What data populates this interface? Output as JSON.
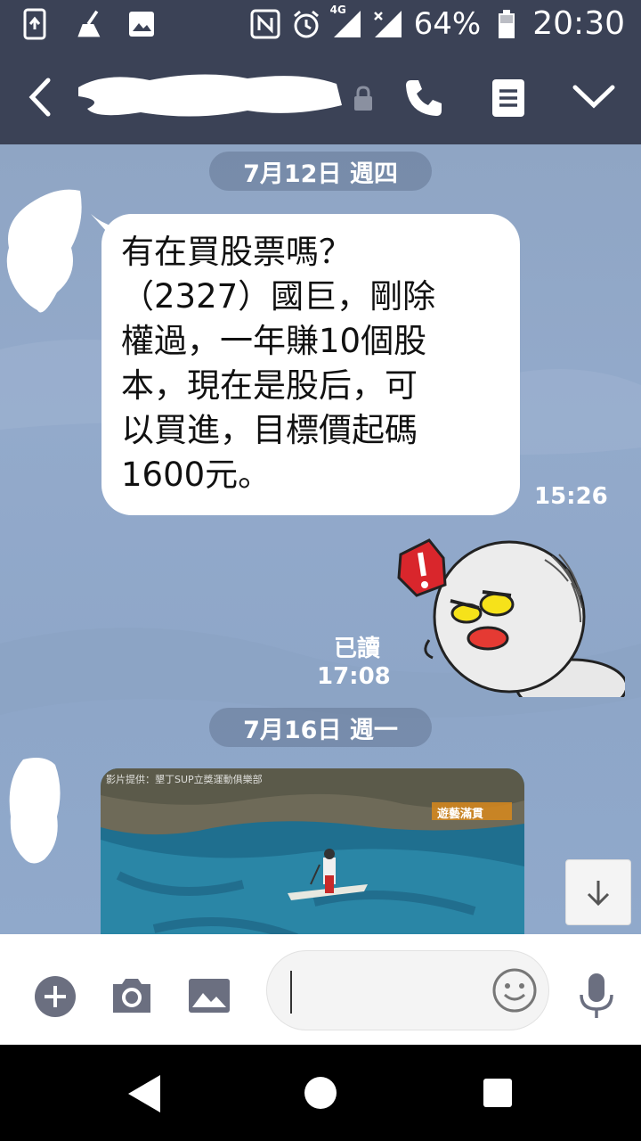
{
  "status_bar": {
    "battery": "64%",
    "time": "20:30",
    "network": "4G",
    "icons": [
      "screen-rotate-icon",
      "cleaner-icon",
      "gallery-icon",
      "nfc-icon",
      "alarm-icon",
      "signal-icon",
      "signal-x-icon",
      "battery-icon"
    ]
  },
  "header": {
    "icons": [
      "back-arrow-icon",
      "lock-icon",
      "phone-icon",
      "notes-icon",
      "chevron-down-icon"
    ]
  },
  "chat": {
    "date_1": "7月12日 週四",
    "message_1": {
      "text": "有在買股票嗎？\n（2327）國巨，剛除\n權過，一年賺10個股\n本，現在是股后，可\n以買進，目標價起碼\n1600元。",
      "time": "15:26"
    },
    "sticker_reply": {
      "read": "已讀",
      "time": "17:08",
      "sticker": "angry-mochi-sticker"
    },
    "date_2": "7月16日 週一",
    "video": {
      "caption": "影片提供：墾丁SUP立獎運動俱樂部",
      "watermark": "遊藝滿貫",
      "description": "paddleboarder on reef water"
    }
  },
  "input_bar": {
    "icons": [
      "plus-icon",
      "camera-icon",
      "image-icon",
      "emoji-icon",
      "microphone-icon"
    ],
    "placeholder": ""
  },
  "nav_bar": {
    "icons": [
      "nav-back-icon",
      "nav-home-icon",
      "nav-recent-icon"
    ]
  },
  "colors": {
    "header_bg": "#3b4256",
    "chat_bg": "#8fa5c4",
    "bubble_bg": "#ffffff",
    "date_pill_bg": "#6a7894"
  }
}
